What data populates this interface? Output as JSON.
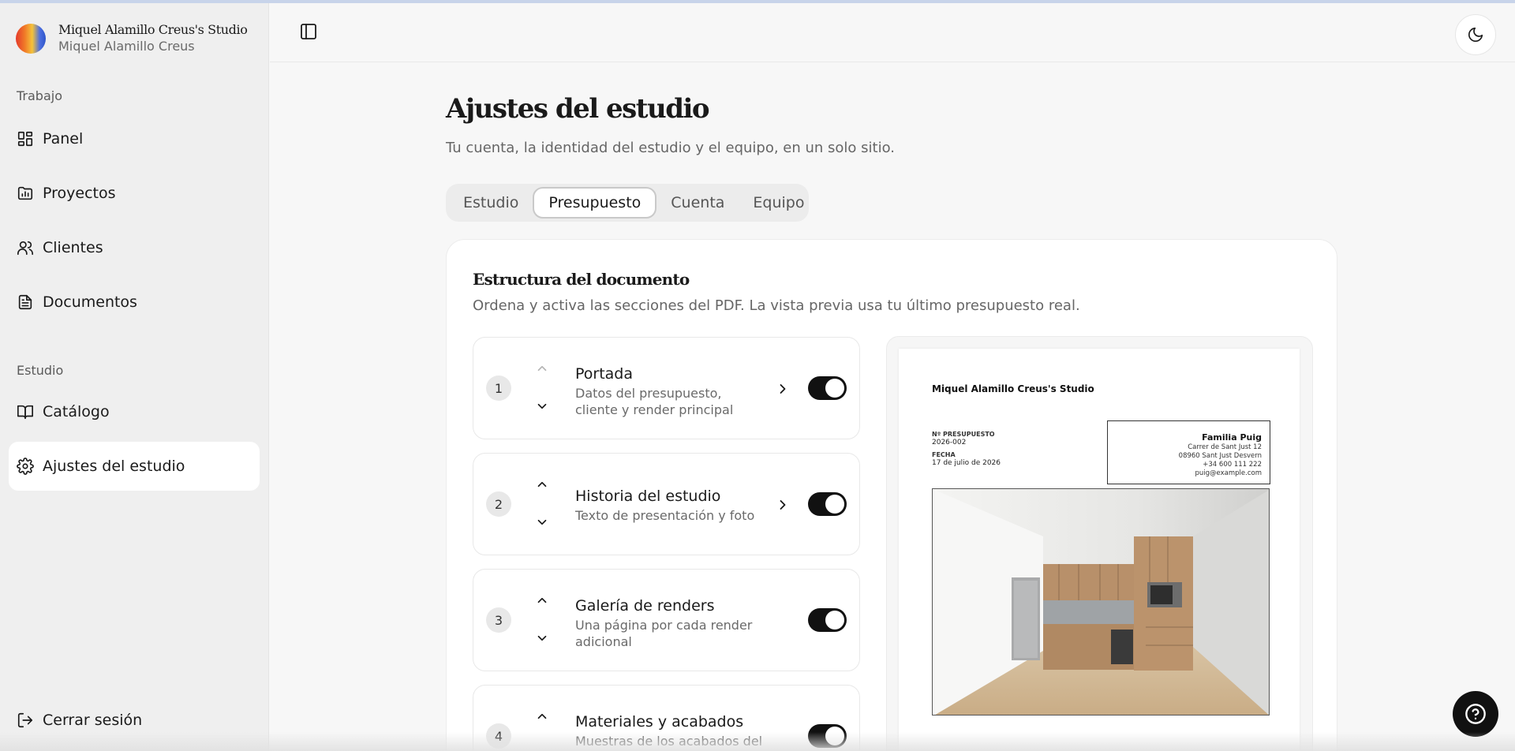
{
  "brand": {
    "title": "Miquel Alamillo Creus's Studio",
    "user": "Miquel Alamillo Creus"
  },
  "sidebar": {
    "groups": [
      {
        "label": "Trabajo",
        "items": [
          {
            "label": "Panel",
            "icon": "layout-grid-icon"
          },
          {
            "label": "Proyectos",
            "icon": "folder-chart-icon"
          },
          {
            "label": "Clientes",
            "icon": "users-icon"
          },
          {
            "label": "Documentos",
            "icon": "file-text-icon"
          }
        ]
      },
      {
        "label": "Estudio",
        "items": [
          {
            "label": "Catálogo",
            "icon": "book-open-icon"
          },
          {
            "label": "Ajustes del estudio",
            "icon": "gear-icon",
            "active": true
          }
        ]
      }
    ],
    "logout": "Cerrar sesión"
  },
  "page": {
    "title": "Ajustes del estudio",
    "subtitle": "Tu cuenta, la identidad del estudio y el equipo, en un solo sitio."
  },
  "tabs": [
    {
      "label": "Estudio",
      "active": false
    },
    {
      "label": "Presupuesto",
      "active": true
    },
    {
      "label": "Cuenta",
      "active": false
    },
    {
      "label": "Equipo",
      "active": false
    }
  ],
  "card": {
    "title": "Estructura del documento",
    "subtitle": "Ordena y activa las secciones del PDF. La vista previa usa tu último presupuesto real."
  },
  "sections": [
    {
      "number": "1",
      "title": "Portada",
      "description": "Datos del presupuesto, cliente y render principal",
      "enabled": true,
      "has_detail": true
    },
    {
      "number": "2",
      "title": "Historia del estudio",
      "description": "Texto de presentación y foto",
      "enabled": true,
      "has_detail": true
    },
    {
      "number": "3",
      "title": "Galería de renders",
      "description": "Una página por cada render adicional",
      "enabled": true,
      "has_detail": false
    },
    {
      "number": "4",
      "title": "Materiales y acabados",
      "description": "Muestras de los acabados del",
      "enabled": true,
      "has_detail": false
    }
  ],
  "preview": {
    "studio_name": "Miquel Alamillo Creus's Studio",
    "budget_number_label": "Nº PRESUPUESTO",
    "budget_number": "2026-002",
    "date_label": "FECHA",
    "date": "17 de julio de 2026",
    "client": {
      "name": "Familia Puig",
      "address": "Carrer de Sant Just 12",
      "city": "08960 Sant Just Desvern",
      "phone": "+34 600 111 222",
      "email": "puig@example.com"
    }
  },
  "colors": {
    "accent": "#111111",
    "sidebar_bg": "#efefef",
    "page_bg": "#f7f7f7"
  }
}
